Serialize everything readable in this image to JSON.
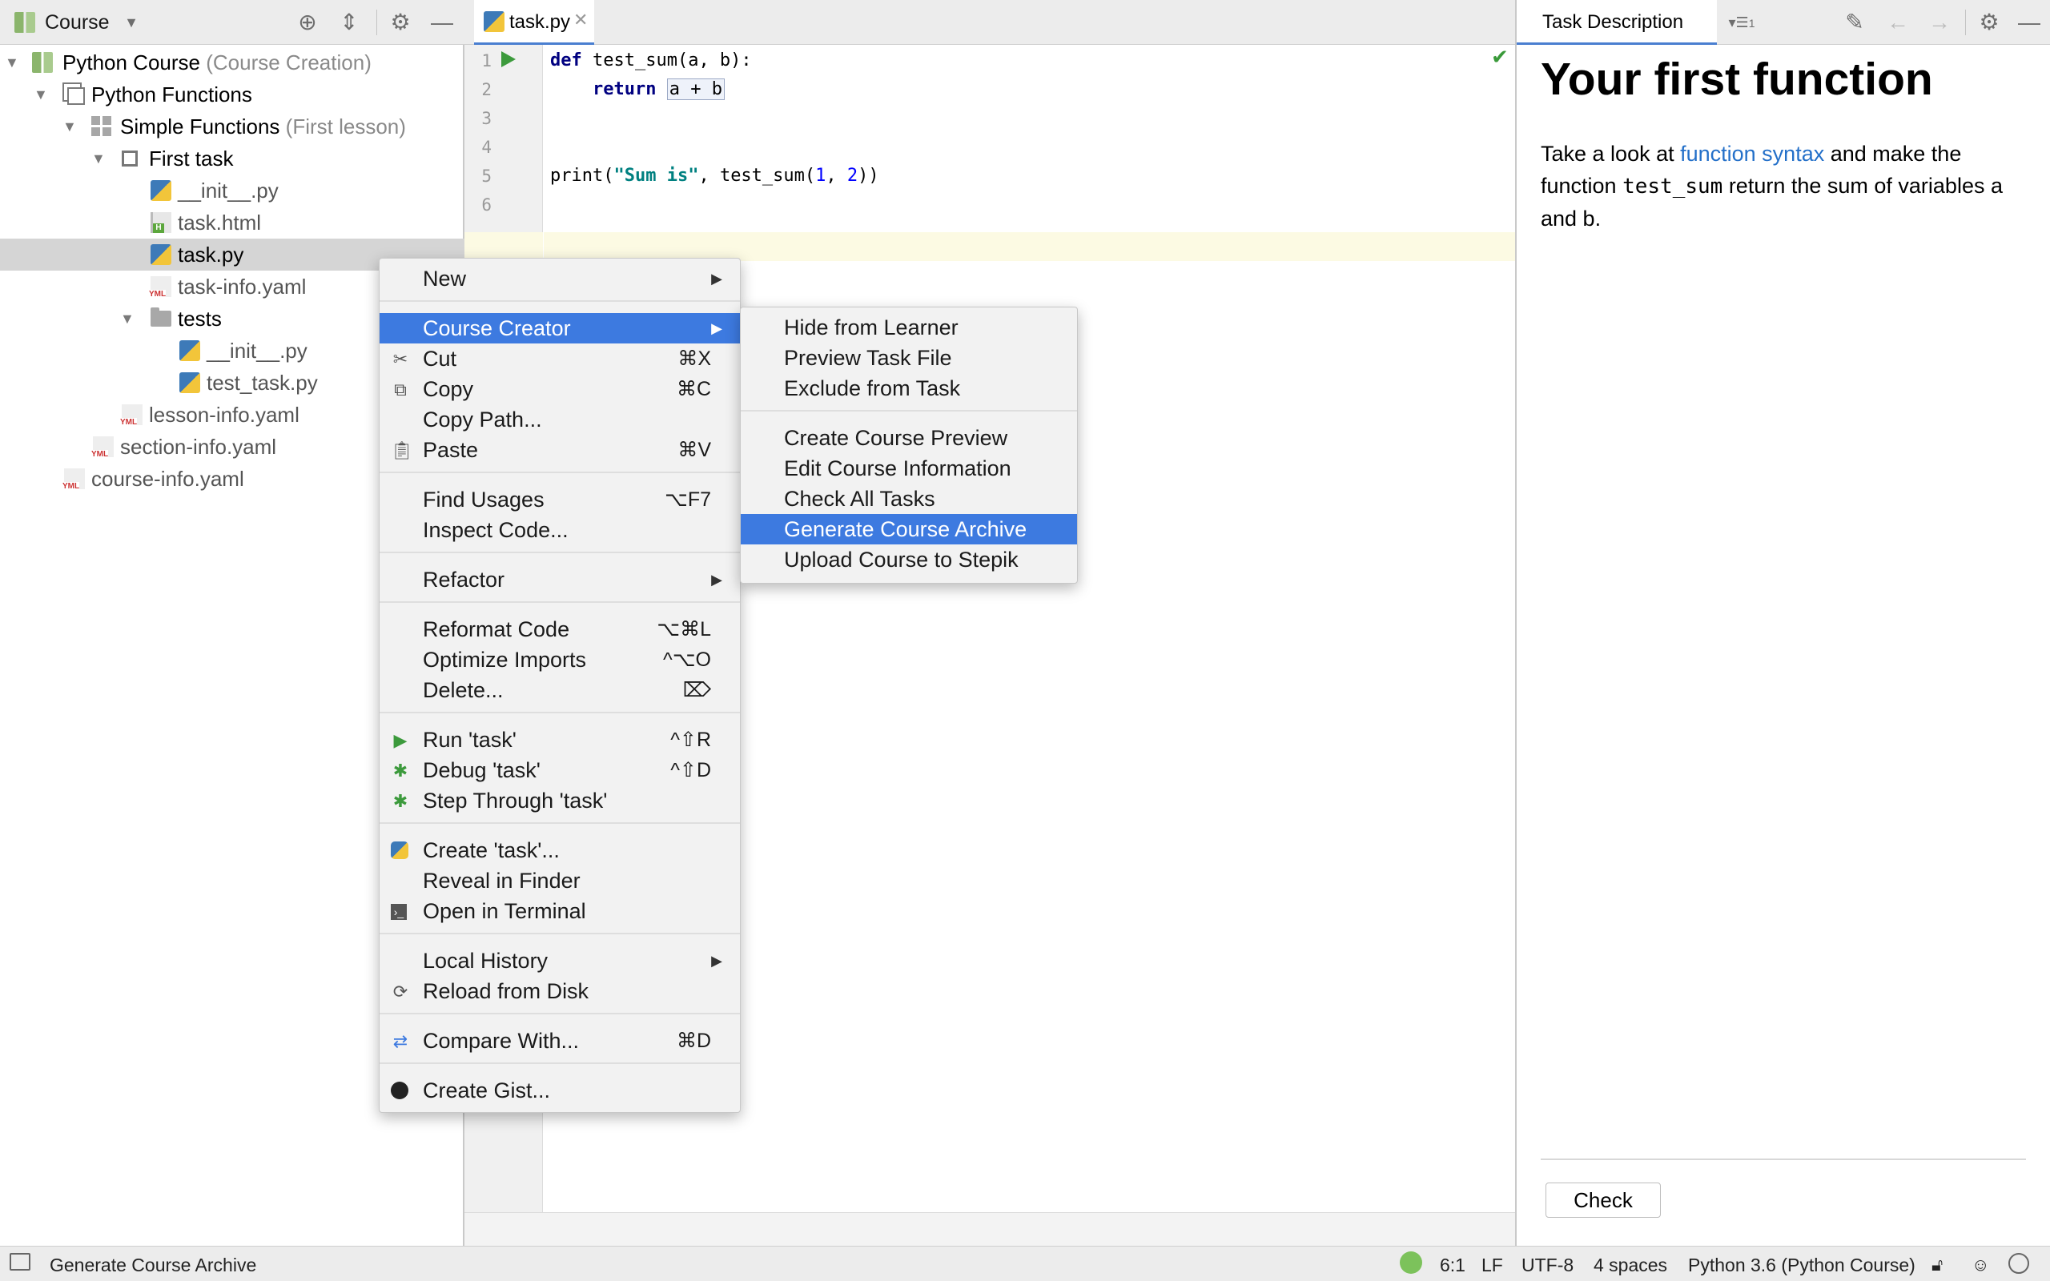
{
  "project": {
    "header_label": "Course",
    "tree": [
      {
        "label": "Python Course",
        "secondary": "(Course Creation)"
      },
      {
        "label": "Python Functions",
        "secondary": ""
      },
      {
        "label": "Simple Functions",
        "secondary": "(First lesson)"
      },
      {
        "label": "First task",
        "secondary": ""
      },
      {
        "label": "__init__.py",
        "secondary": ""
      },
      {
        "label": "task.html",
        "secondary": ""
      },
      {
        "label": "task.py",
        "secondary": ""
      },
      {
        "label": "task-info.yaml",
        "secondary": ""
      },
      {
        "label": "tests",
        "secondary": ""
      },
      {
        "label": "__init__.py",
        "secondary": ""
      },
      {
        "label": "test_task.py",
        "secondary": ""
      },
      {
        "label": "lesson-info.yaml",
        "secondary": ""
      },
      {
        "label": "section-info.yaml",
        "secondary": ""
      },
      {
        "label": "course-info.yaml",
        "secondary": ""
      }
    ]
  },
  "editor": {
    "tab_label": "task.py",
    "line_numbers": [
      "1",
      "2",
      "3",
      "4",
      "5",
      "6"
    ],
    "code": {
      "l1_kw": "def",
      "l1_rest": " test_sum(a, b):",
      "l2_kw": "return",
      "l2_expr": "a + b",
      "l5_fn": "print(",
      "l5_str": "\"Sum is\"",
      "l5_mid": ", test_sum(",
      "l5_n1": "1",
      "l5_comma": ", ",
      "l5_n2": "2",
      "l5_end": "))"
    }
  },
  "context_menu": {
    "items": [
      {
        "label": "New",
        "shortcut": ""
      },
      {
        "label": "Course Creator",
        "shortcut": ""
      },
      {
        "label": "Cut",
        "shortcut": "⌘X"
      },
      {
        "label": "Copy",
        "shortcut": "⌘C"
      },
      {
        "label": "Copy Path...",
        "shortcut": ""
      },
      {
        "label": "Paste",
        "shortcut": "⌘V"
      },
      {
        "label": "Find Usages",
        "shortcut": "⌥F7"
      },
      {
        "label": "Inspect Code...",
        "shortcut": ""
      },
      {
        "label": "Refactor",
        "shortcut": ""
      },
      {
        "label": "Reformat Code",
        "shortcut": "⌥⌘L"
      },
      {
        "label": "Optimize Imports",
        "shortcut": "^⌥O"
      },
      {
        "label": "Delete...",
        "shortcut": "⌦"
      },
      {
        "label": "Run 'task'",
        "shortcut": "^⇧R"
      },
      {
        "label": "Debug 'task'",
        "shortcut": "^⇧D"
      },
      {
        "label": "Step Through 'task'",
        "shortcut": ""
      },
      {
        "label": "Create 'task'...",
        "shortcut": ""
      },
      {
        "label": "Reveal in Finder",
        "shortcut": ""
      },
      {
        "label": "Open in Terminal",
        "shortcut": ""
      },
      {
        "label": "Local History",
        "shortcut": ""
      },
      {
        "label": "Reload from Disk",
        "shortcut": ""
      },
      {
        "label": "Compare With...",
        "shortcut": "⌘D"
      },
      {
        "label": "Create Gist...",
        "shortcut": ""
      }
    ]
  },
  "submenu": {
    "items": [
      "Hide from Learner",
      "Preview Task File",
      "Exclude from Task",
      "Create Course Preview",
      "Edit Course Information",
      "Check All Tasks",
      "Generate Course Archive",
      "Upload Course to Stepik"
    ]
  },
  "task_description": {
    "tab_label": "Task Description",
    "badge": "1",
    "title": "Your first function",
    "body_1": "Take a look at ",
    "link": "function syntax",
    "body_2": " and make the function ",
    "code": "test_sum",
    "body_3": " return the sum of variables a and b.",
    "check_button": "Check"
  },
  "status_bar": {
    "message": "Generate Course Archive",
    "position": "6:1",
    "line_separator": "LF",
    "encoding": "UTF-8",
    "indent": "4 spaces",
    "interpreter": "Python 3.6 (Python Course)"
  },
  "colors": {
    "selection": "#3d7ae0",
    "link": "#2470c9",
    "keyword": "#000080",
    "string": "#008080",
    "number": "#0000ff"
  }
}
